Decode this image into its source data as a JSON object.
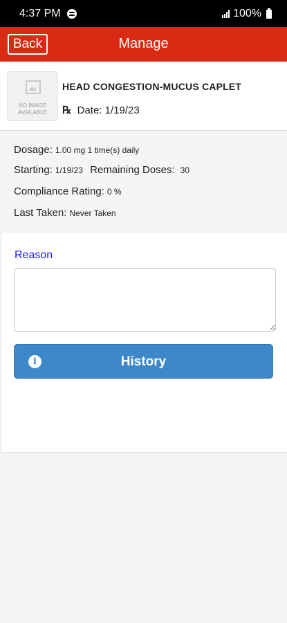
{
  "status_bar": {
    "time": "4:37 PM",
    "battery": "100%"
  },
  "header": {
    "back_label": "Back",
    "title": "Manage"
  },
  "medication": {
    "thumbnail_text": "NO IMAGE AVAILABLE",
    "name": "HEAD CONGESTION-MUCUS CAPLET",
    "rx_symbol": "℞",
    "rx_date_label": "Date:",
    "rx_date": "1/19/23"
  },
  "details": {
    "dosage_label": "Dosage:",
    "dosage_value": "1.00 mg 1 time(s) daily",
    "starting_label": "Starting:",
    "starting_value": "1/19/23",
    "remaining_label": "Remaining Doses:",
    "remaining_value": "30",
    "compliance_label": "Compliance Rating:",
    "compliance_value": "0 %",
    "last_taken_label": "Last Taken:",
    "last_taken_value": "Never Taken"
  },
  "form": {
    "reason_label": "Reason",
    "reason_value": "",
    "history_label": "History"
  },
  "colors": {
    "header": "#d92b14",
    "history_button": "#3d88c8",
    "reason_label": "#1a1aff"
  }
}
